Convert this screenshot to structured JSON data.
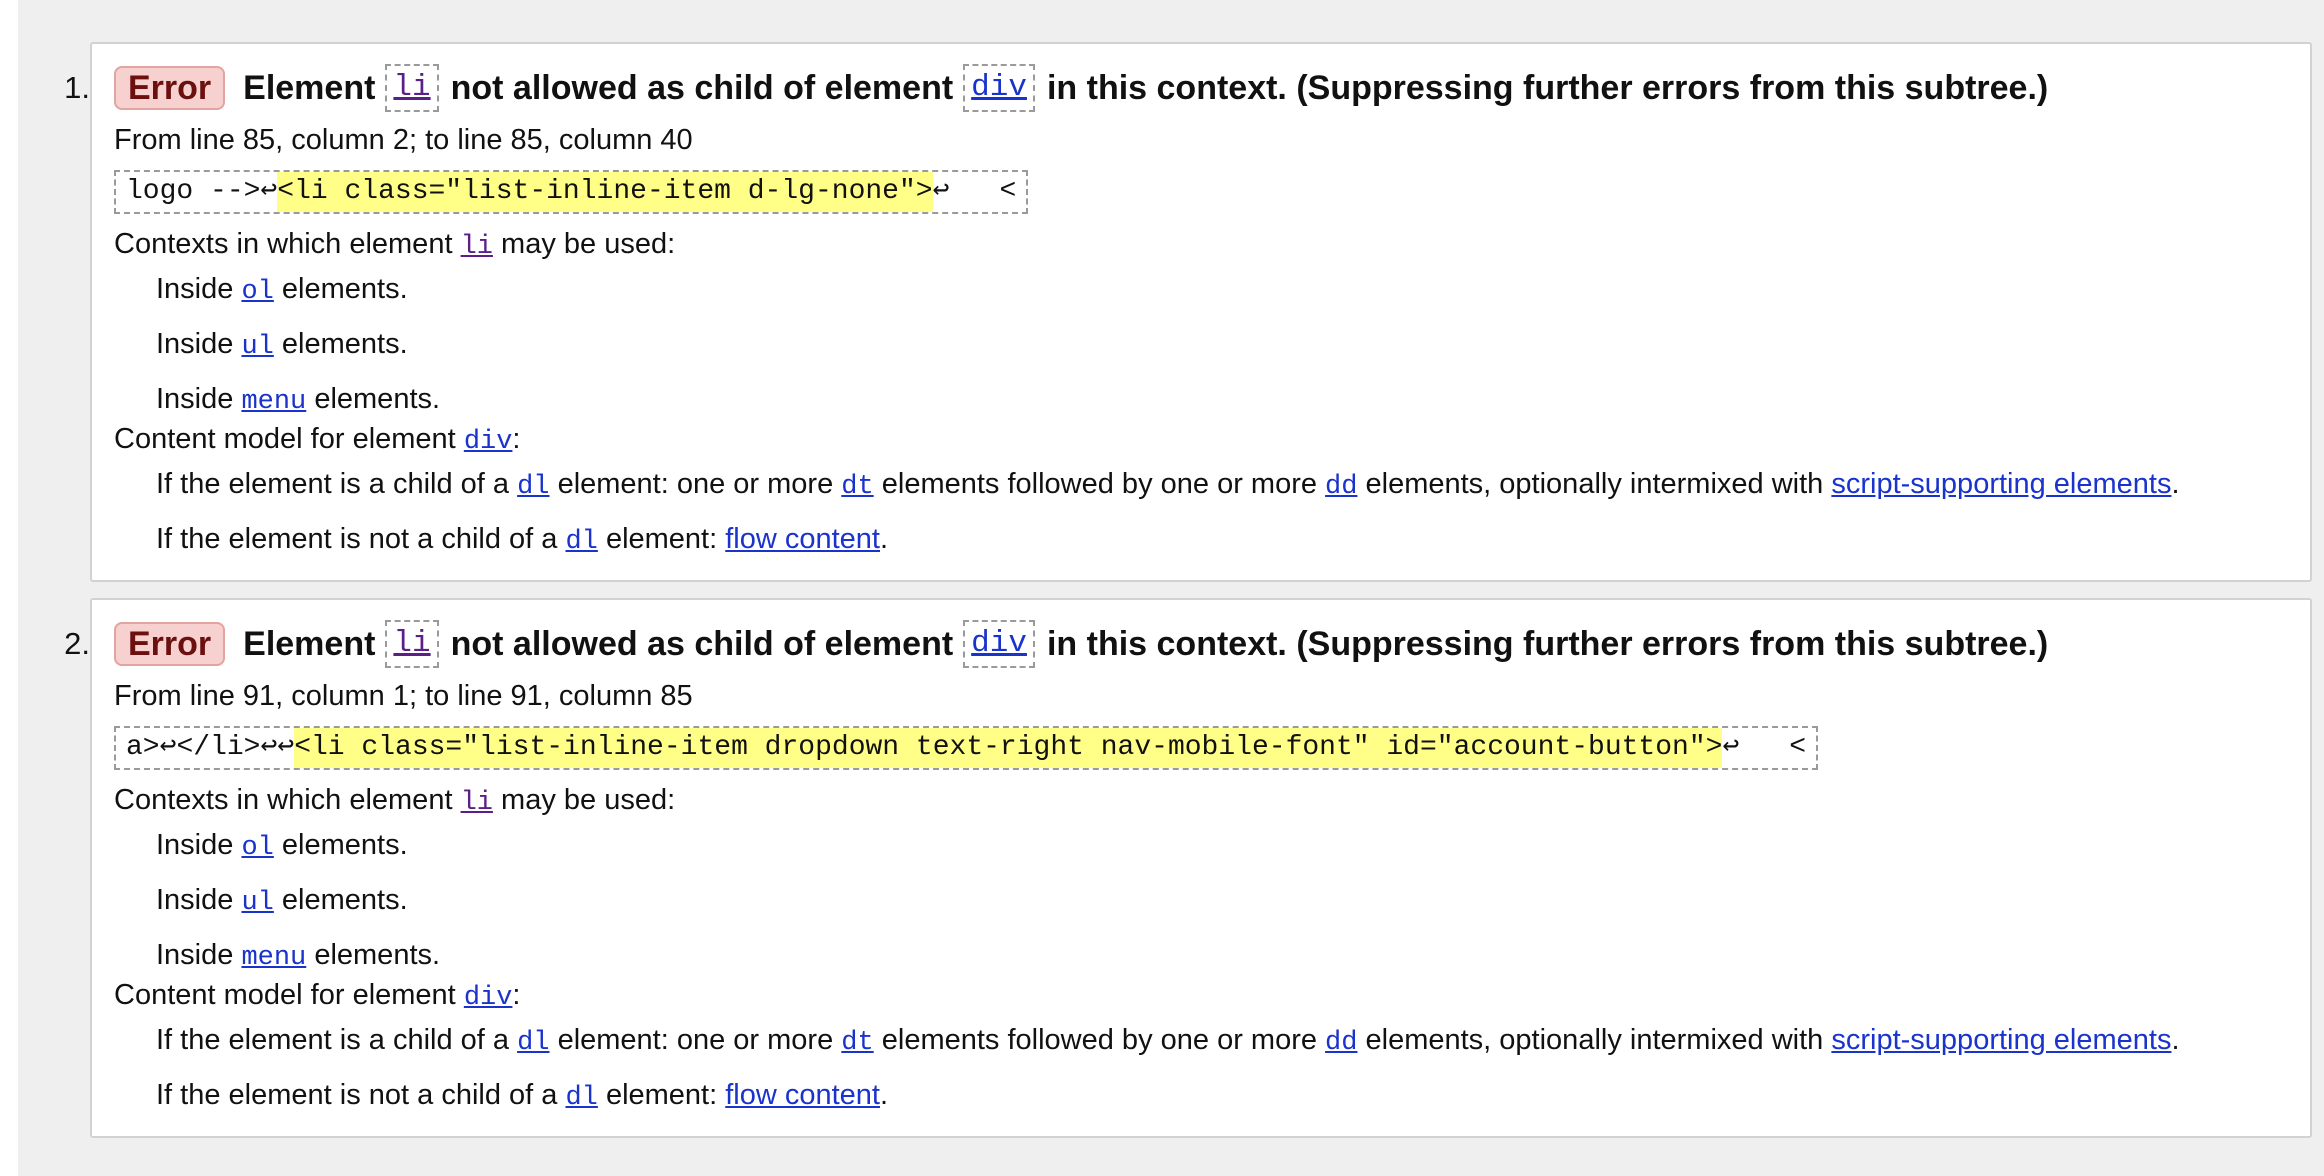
{
  "messages": [
    {
      "number": "1.",
      "badge": "Error",
      "head": {
        "w1": "Element",
        "child": "li",
        "w2": "not allowed as child of element",
        "parent": "div",
        "w3": "in this context. (Suppressing further errors from this subtree.)"
      },
      "location": "From line 85, column 2; to line 85, column 40",
      "extract": {
        "before": "logo -->↩ ",
        "highlight": "<li class=\"list-inline-item d-lg-none\">",
        "after": "↩",
        "tail": "<"
      },
      "contexts_label": "Contexts in which element",
      "contexts_el": "li",
      "contexts_suffix": "may be used:",
      "contexts": [
        {
          "pre": "Inside",
          "el": "ol",
          "post": "elements."
        },
        {
          "pre": "Inside",
          "el": "ul",
          "post": "elements."
        },
        {
          "pre": "Inside",
          "el": "menu",
          "post": "elements."
        }
      ],
      "model_label": "Content model for element",
      "model_el": "div",
      "model_suffix": ":",
      "model_line1": {
        "a": "If the element is a child of a",
        "dl": "dl",
        "b": "element: one or more",
        "dt": "dt",
        "c": "elements followed by one or more",
        "dd": "dd",
        "d": "elements, optionally intermixed with",
        "link": "script-supporting elements",
        "e": "."
      },
      "model_line2": {
        "a": "If the element is not a child of a",
        "dl": "dl",
        "b": "element:",
        "link": "flow content",
        "c": "."
      }
    },
    {
      "number": "2.",
      "badge": "Error",
      "head": {
        "w1": "Element",
        "child": "li",
        "w2": "not allowed as child of element",
        "parent": "div",
        "w3": "in this context. (Suppressing further errors from this subtree.)"
      },
      "location": "From line 91, column 1; to line 91, column 85",
      "extract": {
        "before": "a>↩</li>↩↩",
        "highlight": "<li class=\"list-inline-item dropdown text-right nav-mobile-font\" id=\"account-button\">",
        "after": "↩",
        "tail": "<"
      },
      "contexts_label": "Contexts in which element",
      "contexts_el": "li",
      "contexts_suffix": "may be used:",
      "contexts": [
        {
          "pre": "Inside",
          "el": "ol",
          "post": "elements."
        },
        {
          "pre": "Inside",
          "el": "ul",
          "post": "elements."
        },
        {
          "pre": "Inside",
          "el": "menu",
          "post": "elements."
        }
      ],
      "model_label": "Content model for element",
      "model_el": "div",
      "model_suffix": ":",
      "model_line1": {
        "a": "If the element is a child of a",
        "dl": "dl",
        "b": "element: one or more",
        "dt": "dt",
        "c": "elements followed by one or more",
        "dd": "dd",
        "d": "elements, optionally intermixed with",
        "link": "script-supporting elements",
        "e": "."
      },
      "model_line2": {
        "a": "If the element is not a child of a",
        "dl": "dl",
        "b": "element:",
        "link": "flow content",
        "c": "."
      }
    }
  ],
  "colors": {
    "page_background": "#efefef",
    "panel_border": "#d2d2d2",
    "error_badge_bg": "#f6d1cf",
    "error_badge_text": "#6b0f0f",
    "highlight": "#ffff88",
    "link": "#1a33cc",
    "visited_link": "#5b1f8a"
  }
}
